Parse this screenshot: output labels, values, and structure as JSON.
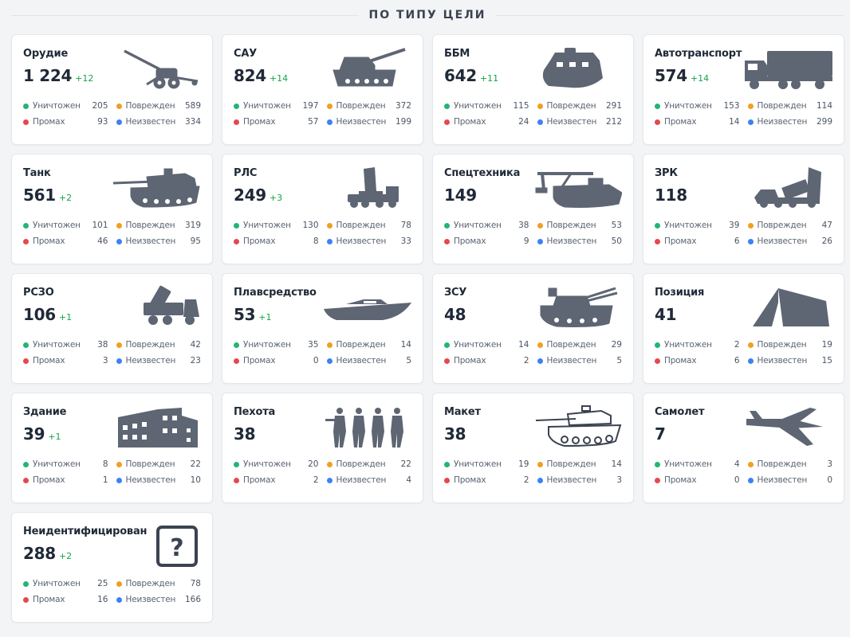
{
  "header": {
    "title": "ПО ТИПУ ЦЕЛИ"
  },
  "labels": {
    "destroyed": "Уничтожен",
    "damaged": "Поврежден",
    "miss": "Промах",
    "unknown": "Неизвестен"
  },
  "colors": {
    "destroyed": "#22b573",
    "damaged": "#f0a020",
    "miss": "#e5484d",
    "unknown": "#3b82f6",
    "delta": "#16a34a",
    "icon": "#5e6573"
  },
  "cards": [
    {
      "name": "Орудие",
      "count": "1 224",
      "delta": "+12",
      "icon": "howitzer-icon",
      "destroyed": "205",
      "damaged": "589",
      "miss": "93",
      "unknown": "334"
    },
    {
      "name": "САУ",
      "count": "824",
      "delta": "+14",
      "icon": "self-propelled-gun-icon",
      "destroyed": "197",
      "damaged": "372",
      "miss": "57",
      "unknown": "199"
    },
    {
      "name": "ББМ",
      "count": "642",
      "delta": "+11",
      "icon": "armored-vehicle-icon",
      "destroyed": "115",
      "damaged": "291",
      "miss": "24",
      "unknown": "212"
    },
    {
      "name": "Автотранспорт",
      "count": "574",
      "delta": "+14",
      "icon": "truck-icon",
      "destroyed": "153",
      "damaged": "114",
      "miss": "14",
      "unknown": "299"
    },
    {
      "name": "Танк",
      "count": "561",
      "delta": "+2",
      "icon": "tank-icon",
      "destroyed": "101",
      "damaged": "319",
      "miss": "46",
      "unknown": "95"
    },
    {
      "name": "РЛС",
      "count": "249",
      "delta": "+3",
      "icon": "radar-icon",
      "destroyed": "130",
      "damaged": "78",
      "miss": "8",
      "unknown": "33"
    },
    {
      "name": "Спецтехника",
      "count": "149",
      "delta": "",
      "icon": "special-vehicle-icon",
      "destroyed": "38",
      "damaged": "53",
      "miss": "9",
      "unknown": "50"
    },
    {
      "name": "ЗРК",
      "count": "118",
      "delta": "",
      "icon": "sam-launcher-icon",
      "destroyed": "39",
      "damaged": "47",
      "miss": "6",
      "unknown": "26"
    },
    {
      "name": "РСЗО",
      "count": "106",
      "delta": "+1",
      "icon": "rocket-launcher-icon",
      "destroyed": "38",
      "damaged": "42",
      "miss": "3",
      "unknown": "23"
    },
    {
      "name": "Плавсредство",
      "count": "53",
      "delta": "+1",
      "icon": "boat-icon",
      "destroyed": "35",
      "damaged": "14",
      "miss": "0",
      "unknown": "5"
    },
    {
      "name": "ЗСУ",
      "count": "48",
      "delta": "",
      "icon": "anti-aircraft-gun-icon",
      "destroyed": "14",
      "damaged": "29",
      "miss": "2",
      "unknown": "5"
    },
    {
      "name": "Позиция",
      "count": "41",
      "delta": "",
      "icon": "tent-icon",
      "destroyed": "2",
      "damaged": "19",
      "miss": "6",
      "unknown": "15"
    },
    {
      "name": "Здание",
      "count": "39",
      "delta": "+1",
      "icon": "building-icon",
      "destroyed": "8",
      "damaged": "22",
      "miss": "1",
      "unknown": "10"
    },
    {
      "name": "Пехота",
      "count": "38",
      "delta": "",
      "icon": "infantry-icon",
      "destroyed": "20",
      "damaged": "22",
      "miss": "2",
      "unknown": "4"
    },
    {
      "name": "Макет",
      "count": "38",
      "delta": "",
      "icon": "decoy-tank-icon",
      "destroyed": "19",
      "damaged": "14",
      "miss": "2",
      "unknown": "3"
    },
    {
      "name": "Самолет",
      "count": "7",
      "delta": "",
      "icon": "jet-icon",
      "destroyed": "4",
      "damaged": "3",
      "miss": "0",
      "unknown": "0"
    },
    {
      "name": "Неидентифицирован",
      "count": "288",
      "delta": "+2",
      "icon": "question-icon",
      "destroyed": "25",
      "damaged": "78",
      "miss": "16",
      "unknown": "166"
    }
  ]
}
